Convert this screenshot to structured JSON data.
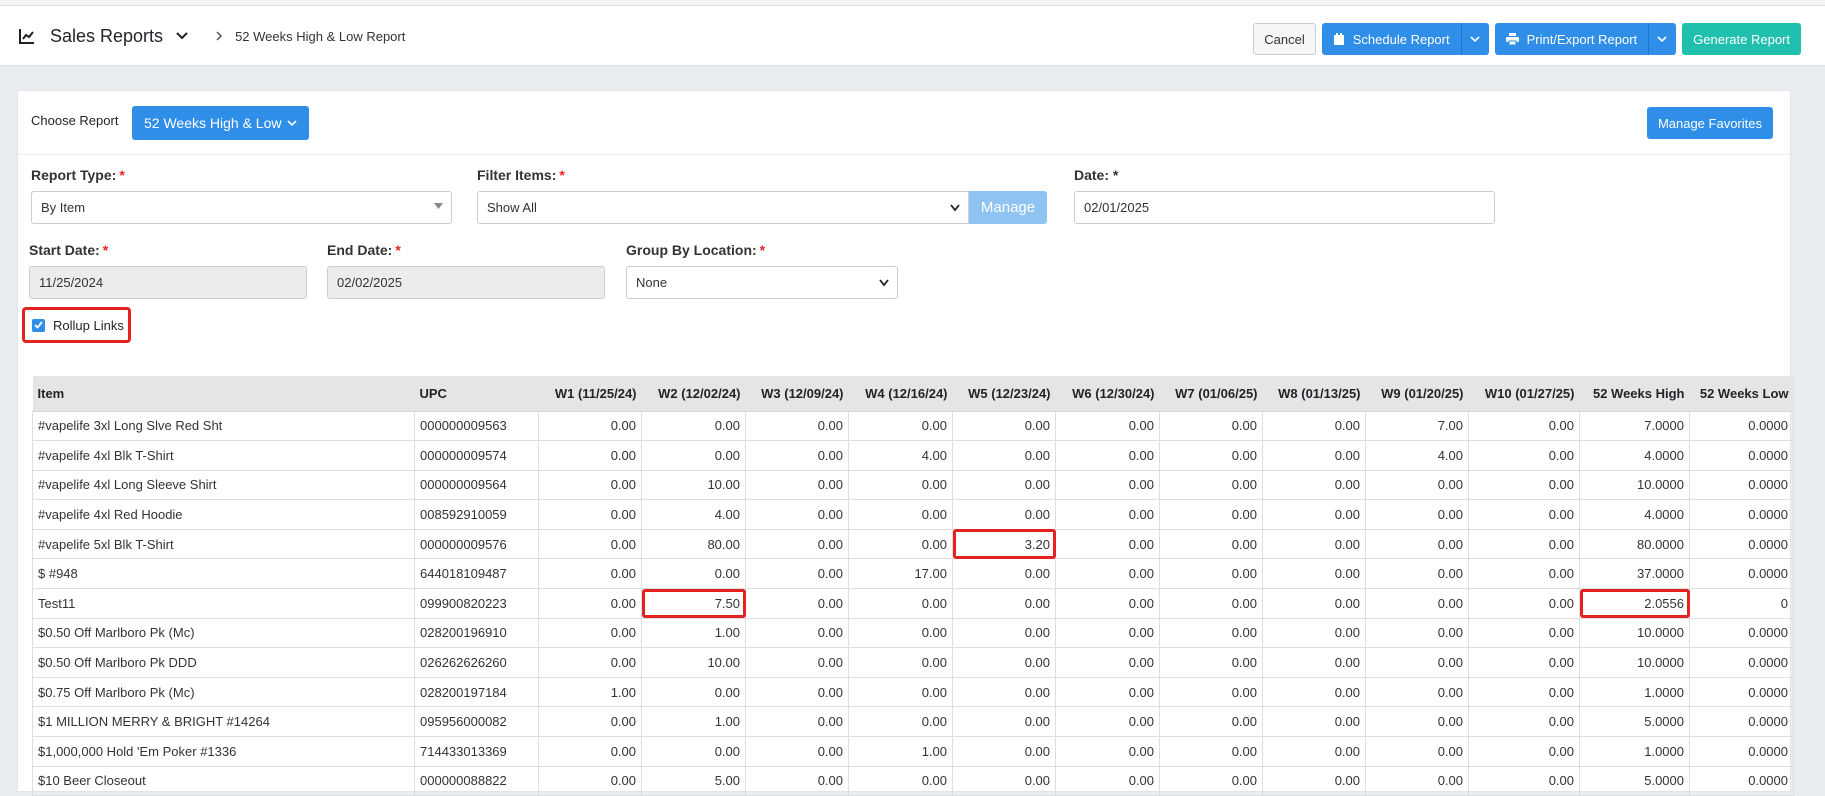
{
  "header": {
    "module_title": "Sales Reports",
    "breadcrumb": "52 Weeks High & Low Report",
    "buttons": {
      "cancel": "Cancel",
      "schedule": "Schedule Report",
      "print_export": "Print/Export Report",
      "generate": "Generate Report"
    }
  },
  "choose": {
    "label": "Choose Report",
    "selected": "52 Weeks High & Low",
    "manage_favorites": "Manage Favorites"
  },
  "form": {
    "report_type_label": "Report Type:",
    "report_type_value": "By Item",
    "filter_items_label": "Filter Items:",
    "filter_items_value": "Show All",
    "manage_label": "Manage",
    "date_label": "Date: *",
    "date_value": "02/01/2025",
    "start_date_label": "Start Date:",
    "start_date_value": "11/25/2024",
    "end_date_label": "End Date:",
    "end_date_value": "02/02/2025",
    "group_by_label": "Group By Location:",
    "group_by_value": "None",
    "required_mark": "*",
    "rollup_label": "Rollup Links",
    "rollup_checked": true
  },
  "table": {
    "columns": [
      "Item",
      "UPC",
      "W1 (11/25/24)",
      "W2 (12/02/24)",
      "W3 (12/09/24)",
      "W4 (12/16/24)",
      "W5 (12/23/24)",
      "W6 (12/30/24)",
      "W7 (01/06/25)",
      "W8 (01/13/25)",
      "W9 (01/20/25)",
      "W10 (01/27/25)",
      "52 Weeks High",
      "52 Weeks Low"
    ],
    "rows": [
      [
        "#vapelife 3xl Long Slve Red Sht",
        "000000009563",
        "0.00",
        "0.00",
        "0.00",
        "0.00",
        "0.00",
        "0.00",
        "0.00",
        "0.00",
        "7.00",
        "0.00",
        "7.0000",
        "0.0000"
      ],
      [
        "#vapelife 4xl Blk T-Shirt",
        "000000009574",
        "0.00",
        "0.00",
        "0.00",
        "4.00",
        "0.00",
        "0.00",
        "0.00",
        "0.00",
        "4.00",
        "0.00",
        "4.0000",
        "0.0000"
      ],
      [
        "#vapelife 4xl Long Sleeve Shirt",
        "000000009564",
        "0.00",
        "10.00",
        "0.00",
        "0.00",
        "0.00",
        "0.00",
        "0.00",
        "0.00",
        "0.00",
        "0.00",
        "10.0000",
        "0.0000"
      ],
      [
        "#vapelife 4xl Red Hoodie",
        "008592910059",
        "0.00",
        "4.00",
        "0.00",
        "0.00",
        "0.00",
        "0.00",
        "0.00",
        "0.00",
        "0.00",
        "0.00",
        "4.0000",
        "0.0000"
      ],
      [
        "#vapelife 5xl Blk T-Shirt",
        "000000009576",
        "0.00",
        "80.00",
        "0.00",
        "0.00",
        "3.20",
        "0.00",
        "0.00",
        "0.00",
        "0.00",
        "0.00",
        "80.0000",
        "0.0000"
      ],
      [
        "$ #948",
        "644018109487",
        "0.00",
        "0.00",
        "0.00",
        "17.00",
        "0.00",
        "0.00",
        "0.00",
        "0.00",
        "0.00",
        "0.00",
        "37.0000",
        "0.0000"
      ],
      [
        "Test11",
        "099900820223",
        "0.00",
        "7.50",
        "0.00",
        "0.00",
        "0.00",
        "0.00",
        "0.00",
        "0.00",
        "0.00",
        "0.00",
        "2.0556",
        "0"
      ],
      [
        "$0.50 Off Marlboro Pk (Mc)",
        "028200196910",
        "0.00",
        "1.00",
        "0.00",
        "0.00",
        "0.00",
        "0.00",
        "0.00",
        "0.00",
        "0.00",
        "0.00",
        "10.0000",
        "0.0000"
      ],
      [
        "$0.50 Off Marlboro Pk DDD",
        "026262626260",
        "0.00",
        "10.00",
        "0.00",
        "0.00",
        "0.00",
        "0.00",
        "0.00",
        "0.00",
        "0.00",
        "0.00",
        "10.0000",
        "0.0000"
      ],
      [
        "$0.75 Off Marlboro Pk (Mc)",
        "028200197184",
        "1.00",
        "0.00",
        "0.00",
        "0.00",
        "0.00",
        "0.00",
        "0.00",
        "0.00",
        "0.00",
        "0.00",
        "1.0000",
        "0.0000"
      ],
      [
        "$1 MILLION MERRY & BRIGHT #14264",
        "095956000082",
        "0.00",
        "1.00",
        "0.00",
        "0.00",
        "0.00",
        "0.00",
        "0.00",
        "0.00",
        "0.00",
        "0.00",
        "5.0000",
        "0.0000"
      ],
      [
        "$1,000,000 Hold 'Em Poker #1336",
        "714433013369",
        "0.00",
        "0.00",
        "0.00",
        "1.00",
        "0.00",
        "0.00",
        "0.00",
        "0.00",
        "0.00",
        "0.00",
        "1.0000",
        "0.0000"
      ],
      [
        "$10 Beer Closeout",
        "000000088822",
        "0.00",
        "5.00",
        "0.00",
        "0.00",
        "0.00",
        "0.00",
        "0.00",
        "0.00",
        "0.00",
        "0.00",
        "5.0000",
        "0.0000"
      ]
    ],
    "highlighted_cells": [
      [
        4,
        6
      ],
      [
        6,
        3
      ],
      [
        6,
        12
      ]
    ],
    "colors": {
      "header_bg": "#e5e5e5",
      "highlight": "#e52222",
      "primary": "#2e8ee8",
      "teal": "#20bfae"
    }
  }
}
